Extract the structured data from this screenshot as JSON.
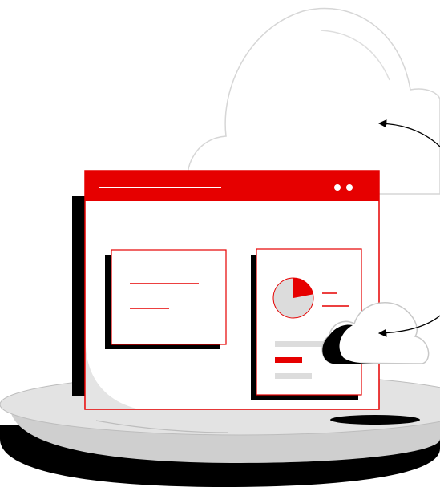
{
  "illustration": {
    "colors": {
      "accent": "#e60000",
      "shadow": "#000000",
      "light_gray": "#dcdcdc",
      "mid_gray": "#cfcfcf",
      "outline_gray": "#d4d4d4",
      "surface": "#ffffff"
    },
    "icons": [
      "cloud-icon",
      "pie-chart-icon",
      "arrow-icon"
    ],
    "pie_chart": {
      "highlighted_fraction": 0.22
    },
    "window": {
      "title_bar_dots": 2
    }
  }
}
